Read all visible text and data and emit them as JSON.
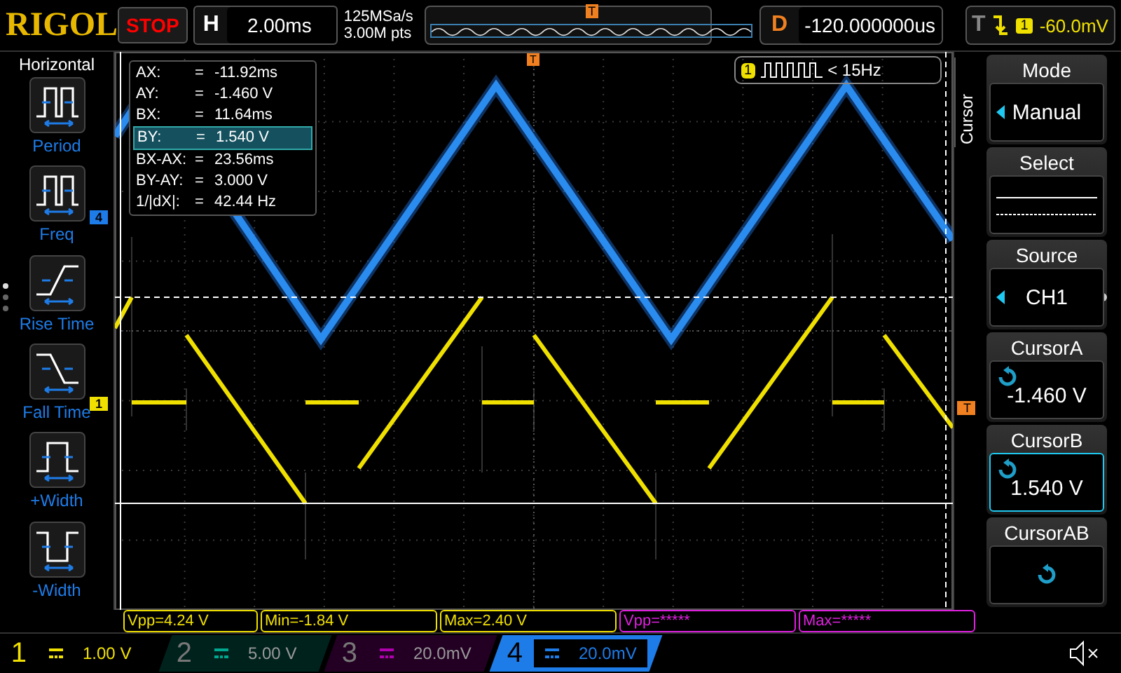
{
  "brand": "RIGOL",
  "run_state": "STOP",
  "timebase": {
    "label": "H",
    "value": "2.00ms"
  },
  "acquisition": {
    "sample_rate": "125MSa/s",
    "memory_depth": "3.00M pts"
  },
  "memory_bar": {
    "marker": "T"
  },
  "delay": {
    "label": "D",
    "value": "-120.000000us"
  },
  "trigger": {
    "label": "T",
    "source": "1",
    "value": "-60.0mV"
  },
  "left_menu": {
    "title": "Horizontal",
    "items": [
      {
        "label": "Period",
        "kind": "period"
      },
      {
        "label": "Freq",
        "kind": "freq"
      },
      {
        "label": "Rise Time",
        "kind": "rise"
      },
      {
        "label": "Fall Time",
        "kind": "fall"
      },
      {
        "label": "+Width",
        "kind": "pwidth"
      },
      {
        "label": "-Width",
        "kind": "nwidth"
      }
    ]
  },
  "cursor_readout": [
    {
      "label": "AX:",
      "sep": "=",
      "value": "-11.92ms",
      "selected": false
    },
    {
      "label": "AY:",
      "sep": "=",
      "value": "-1.460 V",
      "selected": false
    },
    {
      "label": "BX:",
      "sep": "=",
      "value": "11.64ms",
      "selected": false
    },
    {
      "label": "BY:",
      "sep": "=",
      "value": "1.540 V",
      "selected": true
    },
    {
      "label": "BX-AX:",
      "sep": "=",
      "value": "23.56ms",
      "selected": false
    },
    {
      "label": "BY-AY:",
      "sep": "=",
      "value": "3.000 V",
      "selected": false
    },
    {
      "label": "1/|dX|:",
      "sep": "=",
      "value": "42.44 Hz",
      "selected": false
    }
  ],
  "freq_counter": {
    "channel": "1",
    "reading": "< 15Hz"
  },
  "channel_markers": [
    {
      "label": "4",
      "color": "#1e7ce8"
    },
    {
      "label": "1",
      "color": "#f0e000"
    }
  ],
  "trigger_level_marker": {
    "label": "T"
  },
  "trigger_position_marker": {
    "label": "T"
  },
  "right_menu": {
    "tab": "Cursor",
    "items": [
      {
        "title": "Mode",
        "kind": "choice",
        "value": "Manual",
        "selected": false
      },
      {
        "title": "Select",
        "kind": "lines",
        "selected": false
      },
      {
        "title": "Source",
        "kind": "choice",
        "value": "CH1",
        "selected": false
      },
      {
        "title": "CursorA",
        "kind": "knob",
        "value": "-1.460 V",
        "selected": false
      },
      {
        "title": "CursorB",
        "kind": "knob",
        "value": "1.540 V",
        "selected": true
      },
      {
        "title": "CursorAB",
        "kind": "knob",
        "selected": false
      }
    ]
  },
  "measurements": [
    {
      "text": "Vpp=4.24 V",
      "color": "#f0e000"
    },
    {
      "text": "Min=-1.84 V",
      "color": "#f0e000"
    },
    {
      "text": "Max=2.40 V",
      "color": "#f0e000"
    },
    {
      "text": "Vpp=*****",
      "color": "#e020e0"
    },
    {
      "text": "Max=*****",
      "color": "#e020e0"
    }
  ],
  "channels": [
    {
      "number": "1",
      "scale": "1.00 V",
      "on": true,
      "selected": false,
      "color": "#f0e000"
    },
    {
      "number": "2",
      "scale": "5.00 V",
      "on": false,
      "selected": false,
      "color": "#00a890"
    },
    {
      "number": "3",
      "scale": "20.0mV",
      "on": false,
      "selected": false,
      "color": "#b000b0"
    },
    {
      "number": "4",
      "scale": "20.0mV",
      "on": true,
      "selected": true,
      "color": "#1e7ce8"
    }
  ]
}
